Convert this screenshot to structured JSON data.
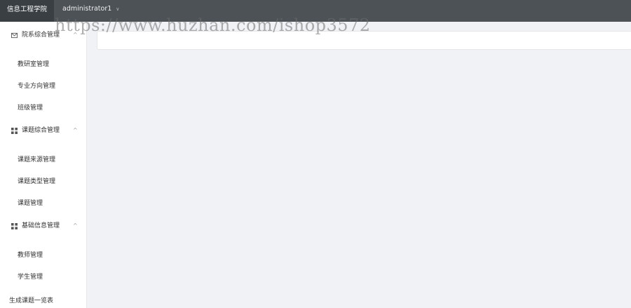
{
  "header": {
    "brand": "信息工程学院",
    "user": "administrator1",
    "user_caret": "∨"
  },
  "sidebar": {
    "groups": [
      {
        "label": "院系综合管理",
        "icon": "mail-icon",
        "arrow": "^",
        "items": [
          "教研室管理",
          "专业方向管理",
          "班级管理"
        ]
      },
      {
        "label": "课题综合管理",
        "icon": "grid-icon",
        "arrow": "^",
        "items": [
          "课题来源管理",
          "课题类型管理",
          "课题管理"
        ]
      },
      {
        "label": "基础信息管理",
        "icon": "grid-icon",
        "arrow": "^",
        "items": [
          "教师管理",
          "学生管理"
        ]
      }
    ],
    "solo_item": "生成课题一览表"
  },
  "watermark": "https://www.huzhan.com/ishop3572",
  "colors": {
    "topbar": "#4d5257",
    "brand_bg": "#3a3f44",
    "sidebar_bg": "#ffffff",
    "content_bg": "#f0f2f5"
  }
}
